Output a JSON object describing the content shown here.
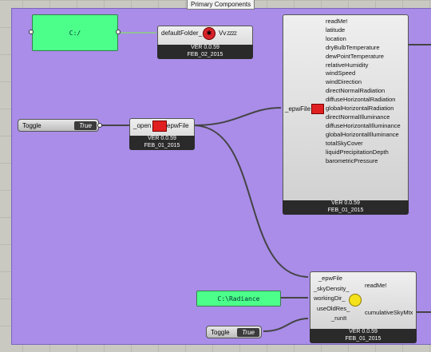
{
  "group_label": "Primary Components",
  "folder_panel": {
    "text": "C:/"
  },
  "radiance_panel": {
    "text": "C:\\Radiance"
  },
  "folder_comp": {
    "input": "defaultFolder_",
    "output": "Vv",
    "version": "VER 0.0.59",
    "date": "FEB_02_2015"
  },
  "toggle1": {
    "label": "Toggle",
    "value": "True"
  },
  "toggle2": {
    "label": "Toggle",
    "value": "True"
  },
  "open_comp": {
    "input": "_open",
    "output": "epwFile",
    "version": "VER 0.0.59",
    "date": "FEB_01_2015"
  },
  "import_comp": {
    "input": "_epwFile",
    "outputs": [
      "readMe!",
      "latitude",
      "location",
      "dryBulbTemperature",
      "dewPointTemperature",
      "relativeHumidity",
      "windSpeed",
      "windDirection",
      "directNormalRadiation",
      "diffuseHorizontalRadiation",
      "globalHorizontalRadiation",
      "directNormalIlluminance",
      "diffuseHorizontalIlluminance",
      "globalHorizontalIlluminance",
      "totalSkyCover",
      "liquidPrecipitationDepth",
      "barometricPressure"
    ],
    "version": "VER 0.0.59",
    "date": "FEB_01_2015"
  },
  "sky_comp": {
    "inputs": [
      "_epwFile",
      "_skyDensity_",
      "workingDir_",
      "useOldRes_",
      "_runIt"
    ],
    "outputs": [
      "readMe!",
      "cumulativeSkyMtx"
    ],
    "version": "VER 0.0.59",
    "date": "FEB_01_2015"
  }
}
